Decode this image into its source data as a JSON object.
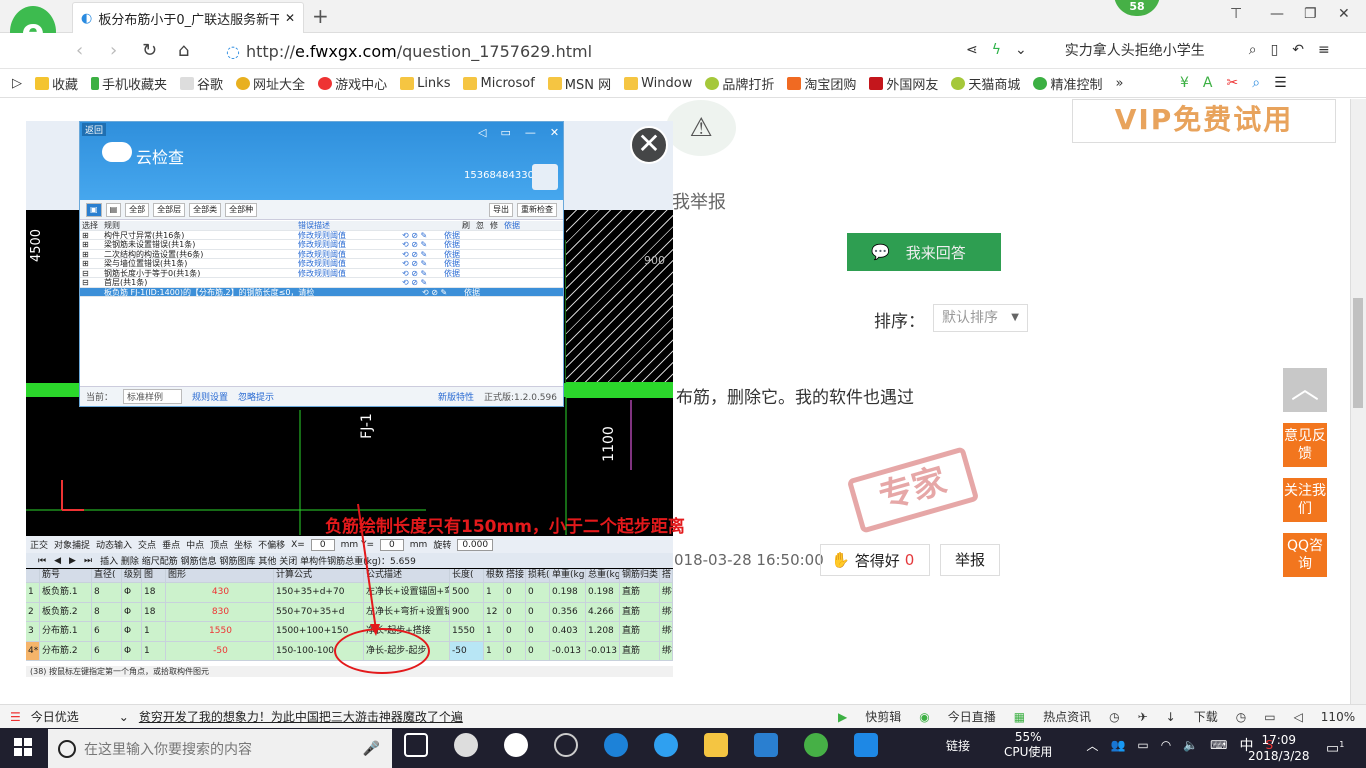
{
  "browser": {
    "logo": "e",
    "tab_title": "板分布筋小于0_广联达服务新干",
    "new_tab": "+",
    "badge": "58",
    "url_scheme": "http://",
    "url_host": "e.fwxgx.com",
    "url_path": "/question_1757629.html",
    "search_text": "实力拿人头拒绝小学生",
    "bookmarks": [
      "收藏",
      "手机收藏夹",
      "谷歌",
      "网址大全",
      "游戏中心",
      "Links",
      "Microsof",
      "MSN 网",
      "Window",
      "品牌打折",
      "淘宝团购",
      "外国网友",
      "天猫商城",
      "精准控制"
    ],
    "more": "»"
  },
  "page": {
    "vip_banner": "VIP免费试用",
    "report_label": "我举报",
    "answer_button": "我来回答",
    "sort_label": "排序：",
    "sort_value": "默认排序",
    "answer_text": "布筋，删除它。我的软件也遇过",
    "stamp": "专家",
    "answer_date": "018-03-28 16:50:00",
    "good_label": "答得好",
    "good_count": "0",
    "report_button": "举报",
    "side_feedback": "意见反馈",
    "side_follow": "关注我们",
    "side_qq": "QQ咨询"
  },
  "screenshot": {
    "dialog": {
      "back": "返回",
      "title": "云检查",
      "phone": "15368484330",
      "toolbar": [
        "全部",
        "全部层",
        "全部类",
        "全部种",
        "导出",
        "重新检查"
      ],
      "headers": [
        "选择",
        "规则",
        "错误描述",
        "",
        "",
        "刷",
        "忽",
        "修",
        "依据"
      ],
      "rows": [
        {
          "rule": "构件尺寸异常(共16条)",
          "action": "修改规则阈值",
          "basis": "依据"
        },
        {
          "rule": "梁钢筋未设置错误(共1条)",
          "action": "修改规则阈值",
          "basis": "依据"
        },
        {
          "rule": "二次结构的构造设置(共6条)",
          "action": "修改规则阈值",
          "basis": "依据"
        },
        {
          "rule": "梁与墙位置错误(共1条)",
          "action": "修改规则阈值",
          "basis": "依据"
        },
        {
          "rule": "钢筋长度小于等于0(共1条)",
          "action": "修改规则阈值",
          "basis": "依据"
        },
        {
          "rule": "首层(共1条)",
          "action": "",
          "basis": ""
        },
        {
          "rule": "板负筋 FJ-1(ID:1400)的【分布筋.2】的钢筋长度≤0，请检",
          "action": "",
          "basis": "依据"
        }
      ],
      "footer_current": "当前：",
      "footer_sel": "标准样例",
      "footer_rules": "规则设置",
      "footer_ignore": "忽略提示",
      "footer_new": "新版特性",
      "footer_version": "正式版:1.2.0.596"
    },
    "cad_labels": {
      "v1": "1100",
      "v2": "FJ-1",
      "v3": "4500",
      "v4": "900"
    },
    "annotation": "负筋绘制长度只有150mm，小于二个起步距离",
    "grid_toolbar1": [
      "正交",
      "对象捕捉",
      "动态输入",
      "交点",
      "垂点",
      "中点",
      "顶点",
      "坐标",
      "不偏移",
      "X=",
      "0",
      "mm Y=",
      "0",
      "mm",
      "旋转",
      "0.000"
    ],
    "grid_toolbar2": "插入  删除  缩尺配筋  钢筋信息  钢筋图库  其他  关闭  单构件钢筋总重(kg)：5.659",
    "grid_headers": [
      "",
      "筋号",
      "直径(",
      "级别",
      "图",
      "图形",
      "计算公式",
      "公式描述",
      "长度(",
      "根数",
      "搭接",
      "损耗(",
      "单重(kg",
      "总重(kg",
      "钢筋归类",
      "搭"
    ],
    "grid_rows": [
      {
        "n": "1",
        "name": "板负筋.1",
        "d": "8",
        "g": "Φ",
        "f": "18",
        "shape": "430",
        "calc": "150+35+d+70",
        "desc": "左净长+设置锚固+弯折",
        "len": "500",
        "count": "1",
        "lap": "0",
        "loss": "0",
        "uw": "0.198",
        "tw": "0.198",
        "type": "直筋",
        "tail": "绑扎"
      },
      {
        "n": "2",
        "name": "板负筋.2",
        "d": "8",
        "g": "Φ",
        "f": "18",
        "shape": "830",
        "calc": "550+70+35+d",
        "desc": "左净长+弯折+设置锚固",
        "len": "900",
        "count": "12",
        "lap": "0",
        "loss": "0",
        "uw": "0.356",
        "tw": "4.266",
        "type": "直筋",
        "tail": "绑扎"
      },
      {
        "n": "3",
        "name": "分布筋.1",
        "d": "6",
        "g": "Φ",
        "f": "1",
        "shape": "1550",
        "calc": "1500+100+150",
        "desc": "净长-起步+搭接",
        "len": "1550",
        "count": "1",
        "lap": "0",
        "loss": "0",
        "uw": "0.403",
        "tw": "1.208",
        "type": "直筋",
        "tail": "绑扎"
      },
      {
        "n": "4*",
        "name": "分布筋.2",
        "d": "6",
        "g": "Φ",
        "f": "1",
        "shape": "-50",
        "calc": "150-100-100",
        "desc": "净长-起步-起步",
        "len": "-50",
        "count": "1",
        "lap": "0",
        "loss": "0",
        "uw": "-0.013",
        "tw": "-0.013",
        "type": "直筋",
        "tail": "绑扎"
      }
    ],
    "grid_status": "(38) 按鼠标左键指定第一个角点，或拾取构件图元"
  },
  "statusbar": {
    "left1": "今日优选",
    "left2": "贫穷开发了我的想象力！为此中国把三大游击神器魔改了个遍",
    "right": [
      "快剪辑",
      "今日直播",
      "热点资讯",
      "下载",
      "110%"
    ]
  },
  "taskbar": {
    "search_placeholder": "在这里输入你要搜索的内容",
    "link": "链接",
    "cpu_pct": "55%",
    "cpu_label": "CPU使用",
    "ime": "中",
    "time": "17:09",
    "date": "2018/3/28",
    "notif": "1"
  }
}
